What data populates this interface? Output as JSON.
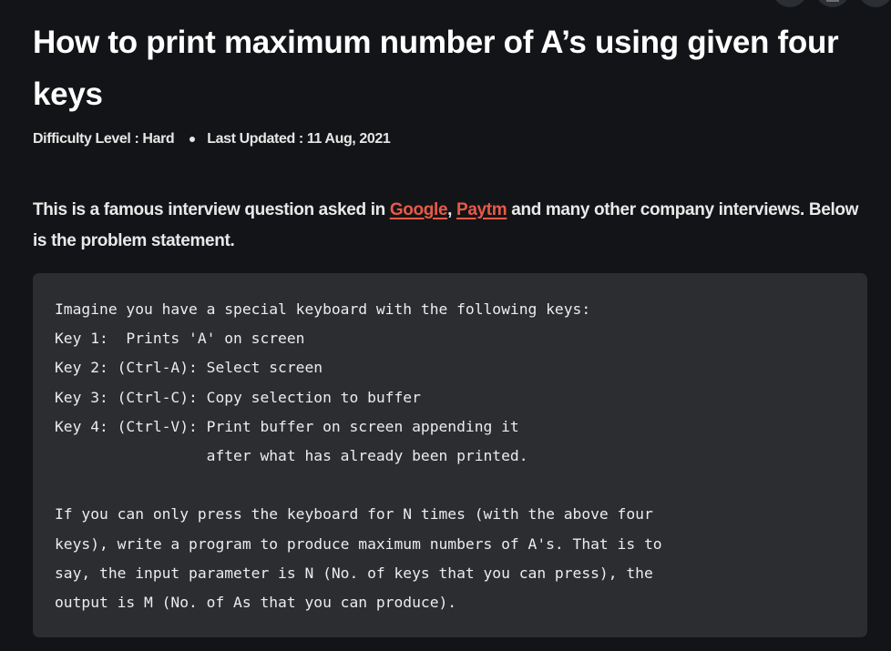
{
  "article": {
    "title": "How to print maximum number of A’s using given four keys",
    "difficulty": "Difficulty Level : Hard",
    "last_updated": "Last Updated : 11 Aug, 2021",
    "intro_before": "This is a famous interview question asked in ",
    "link_google": "Google",
    "comma": ", ",
    "link_paytm": "Paytm",
    "intro_after": " and many other company interviews. Below is the problem statement.",
    "code_lines": [
      "Imagine you have a special keyboard with the following keys:",
      "Key 1:  Prints 'A' on screen",
      "Key 2: (Ctrl-A): Select screen",
      "Key 3: (Ctrl-C): Copy selection to buffer",
      "Key 4: (Ctrl-V): Print buffer on screen appending it",
      "                 after what has already been printed.",
      "",
      "If you can only press the keyboard for N times (with the above four",
      "keys), write a program to produce maximum numbers of A's. That is to",
      "say, the input parameter is N (No. of keys that you can press), the",
      "output is M (No. of As that you can produce)."
    ]
  },
  "colors": {
    "background": "#131417",
    "code_background": "#2c2d31",
    "link": "#e85a48"
  }
}
